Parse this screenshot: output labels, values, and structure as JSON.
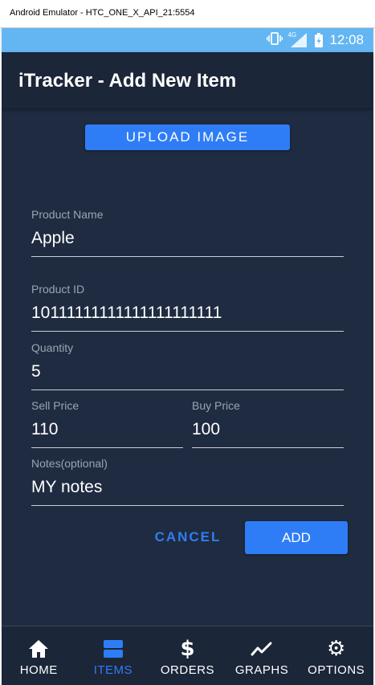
{
  "window": {
    "title": "Android Emulator - HTC_ONE_X_API_21:5554"
  },
  "statusbar": {
    "network": "4G",
    "time": "12:08",
    "icons": [
      "vibrate-icon",
      "signal-icon",
      "battery-icon"
    ]
  },
  "appbar": {
    "title": "iTracker - Add New Item"
  },
  "upload": {
    "label": "UPLOAD IMAGE"
  },
  "form": {
    "product_name": {
      "label": "Product Name",
      "value": "Apple"
    },
    "product_id": {
      "label": "Product ID",
      "value": "10111111111111111111111"
    },
    "quantity": {
      "label": "Quantity",
      "value": "5"
    },
    "sell_price": {
      "label": "Sell Price",
      "value": "110"
    },
    "buy_price": {
      "label": "Buy Price",
      "value": "100"
    },
    "notes": {
      "label": "Notes(optional)",
      "value": "MY notes"
    }
  },
  "actions": {
    "cancel_label": "CANCEL",
    "add_label": "ADD"
  },
  "nav": {
    "items": [
      {
        "label": "HOME",
        "icon": "home-icon",
        "active": false
      },
      {
        "label": "ITEMS",
        "icon": "items-icon",
        "active": true
      },
      {
        "label": "ORDERS",
        "icon": "dollar-icon",
        "active": false
      },
      {
        "label": "GRAPHS",
        "icon": "trend-icon",
        "active": false
      },
      {
        "label": "OPTIONS",
        "icon": "gear-icon",
        "active": false
      }
    ]
  },
  "colors": {
    "background": "#1f2b40",
    "appbar": "#1b2638",
    "statusbar": "#64b6f2",
    "accent": "#2f7df6",
    "label": "#9aa4b4",
    "underline": "#c9ced6"
  }
}
